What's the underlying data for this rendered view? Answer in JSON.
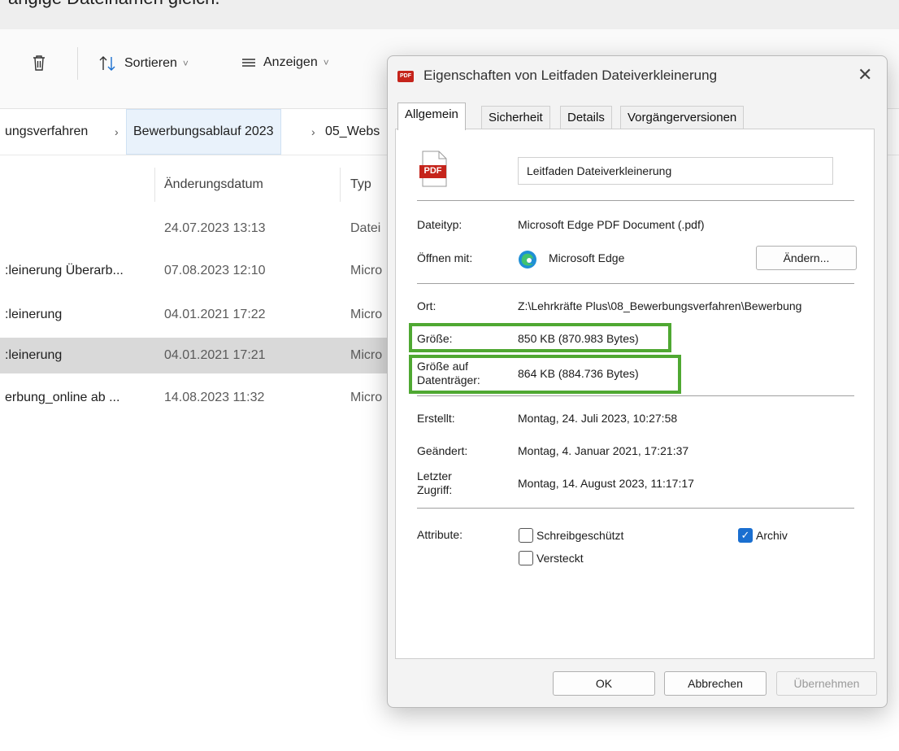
{
  "top_text": "ängige Dateinamen gleich.",
  "toolbar": {
    "sort_label": "Sortieren",
    "view_label": "Anzeigen",
    "chevron": "˅"
  },
  "breadcrumb": {
    "items": [
      "ungsverfahren",
      "Bewerbungsablauf 2023",
      "05_Webs"
    ],
    "separator": "›"
  },
  "columns": {
    "date": "Änderungsdatum",
    "type": "Typ"
  },
  "files": [
    {
      "name": "",
      "date": "24.07.2023 13:13",
      "type": "Datei",
      "selected": false
    },
    {
      "name": ":leinerung Überarb...",
      "date": "07.08.2023 12:10",
      "type": "Micro",
      "selected": false
    },
    {
      "name": ":leinerung",
      "date": "04.01.2021 17:22",
      "type": "Micro",
      "selected": false
    },
    {
      "name": ":leinerung",
      "date": "04.01.2021 17:21",
      "type": "Micro",
      "selected": true
    },
    {
      "name": "erbung_online ab ...",
      "date": "14.08.2023 11:32",
      "type": "Micro",
      "selected": false
    }
  ],
  "dialog": {
    "title": "Eigenschaften von Leitfaden Dateiverkleinerung",
    "close": "✕",
    "icon_text": "PDF",
    "tabs": [
      "Allgemein",
      "Sicherheit",
      "Details",
      "Vorgängerversionen"
    ],
    "filename": "Leitfaden Dateiverkleinerung",
    "file_icon_text": "PDF",
    "filetype_label": "Dateityp:",
    "filetype_value": "Microsoft Edge PDF Document (.pdf)",
    "openwith_label": "Öffnen mit:",
    "openwith_value": "Microsoft Edge",
    "change_button": "Ändern...",
    "location_label": "Ort:",
    "location_value": "Z:\\Lehrkräfte Plus\\08_Bewerbungsverfahren\\Bewerbung",
    "size_label": "Größe:",
    "size_value": "850 KB (870.983 Bytes)",
    "disk_label_1": "Größe auf",
    "disk_label_2": "Datenträger:",
    "disk_value": "864 KB (884.736 Bytes)",
    "created_label": "Erstellt:",
    "created_value": "Montag, 24. Juli 2023, 10:27:58",
    "modified_label": "Geändert:",
    "modified_value": "Montag, 4. Januar 2021, 17:21:37",
    "accessed_label_1": "Letzter",
    "accessed_label_2": "Zugriff:",
    "accessed_value": "Montag, 14. August 2023, 11:17:17",
    "attributes_label": "Attribute:",
    "readonly_label": "Schreibgeschützt",
    "readonly_checked": false,
    "hidden_label": "Versteckt",
    "hidden_checked": false,
    "archive_label": "Archiv",
    "archive_checked": true,
    "ok_button": "OK",
    "cancel_button": "Abbrechen",
    "apply_button": "Übernehmen",
    "highlight_color": "#4fa832",
    "pdf_red": "#c5241b",
    "check_blue": "#1a6fd0"
  }
}
